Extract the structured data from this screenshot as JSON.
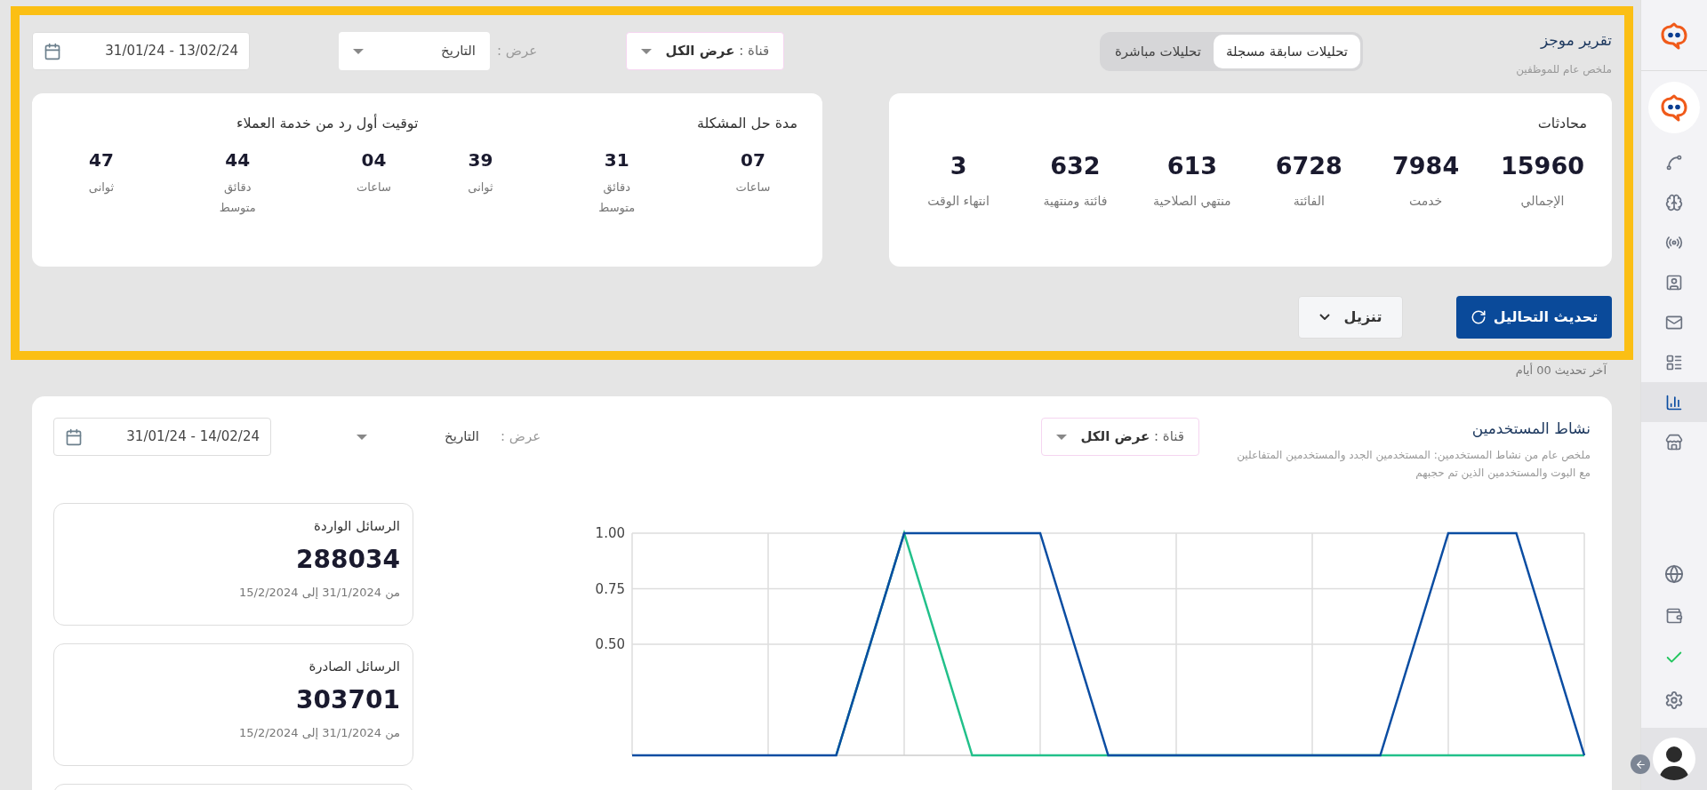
{
  "highlight_frame": true,
  "summary": {
    "title": "تقرير موجز",
    "subtitle": "ملخص عام للموظفين",
    "tabs": [
      {
        "label": "تحليلات سابقة مسجلة",
        "selected": true
      },
      {
        "label": "تحليلات مباشرة",
        "selected": false
      }
    ],
    "channel_filter": {
      "label": "قناة :",
      "value": "عرض الكل"
    },
    "view_filter": {
      "label": "عرض :",
      "value": "التاريخ"
    },
    "date_range": "31/01/24 - 13/02/24",
    "conversations": {
      "title": "محادثات",
      "stats": [
        {
          "value": "15960",
          "label": "الإجمالي"
        },
        {
          "value": "7984",
          "label": "خدمت"
        },
        {
          "value": "6728",
          "label": "الفائتة"
        },
        {
          "value": "613",
          "label": "منتهي الصلاحية"
        },
        {
          "value": "632",
          "label": "فائتة ومنتهية"
        },
        {
          "value": "3",
          "label": "انتهاء الوقت"
        }
      ]
    },
    "timing": [
      {
        "title": "مدة حل المشكلة",
        "stats": [
          {
            "value": "07",
            "label": "ساعات"
          },
          {
            "value": "31",
            "label": "دقائق",
            "note": "متوسط"
          },
          {
            "value": "39",
            "label": "ثوانى"
          }
        ]
      },
      {
        "title": "توقيت أول رد من خدمة العملاء",
        "stats": [
          {
            "value": "04",
            "label": "ساعات"
          },
          {
            "value": "44",
            "label": "دقائق",
            "note": "متوسط"
          },
          {
            "value": "47",
            "label": "ثوانى"
          }
        ]
      }
    ],
    "refresh_button": "تحديث التحاليل",
    "download_button": "تنزيل",
    "last_update": "آخر تحديث 00 أيام"
  },
  "activity": {
    "title": "نشاط المستخدمين",
    "subtitle": "ملخص عام من نشاط المستخدمين: المستخدمين الجدد والمستخدمين المتفاعلين مع البوت والمستخدمين الذين تم حجبهم",
    "channel_filter": {
      "label": "قناة :",
      "value": "عرض الكل"
    },
    "view_filter": {
      "label": "عرض :",
      "value": "التاريخ"
    },
    "date_range": "31/01/24 - 14/02/24",
    "metrics": [
      {
        "title": "الرسائل الواردة",
        "value": "288034",
        "period": "من 31/1/2024 إلى 15/2/2024"
      },
      {
        "title": "الرسائل الصادرة",
        "value": "303701",
        "period": "من 31/1/2024 إلى 15/2/2024"
      }
    ],
    "chart_data": {
      "type": "line",
      "grid": true,
      "ylim": [
        0,
        1
      ],
      "yticks": [
        {
          "value": 0.5,
          "label": "0.50"
        },
        {
          "value": 0.75,
          "label": "0.75"
        },
        {
          "value": 1,
          "label": "1.00"
        }
      ],
      "series": [
        {
          "color": "#22c08a",
          "values": [
            null,
            null,
            null,
            0,
            1,
            0,
            0,
            0,
            0,
            0,
            0,
            0,
            0,
            0,
            0
          ]
        },
        {
          "color": "#0b4da2",
          "values": [
            0,
            0,
            0,
            0,
            1,
            1,
            1,
            0,
            0,
            0,
            0,
            0,
            1,
            1,
            0
          ]
        }
      ]
    }
  },
  "sidebar": {
    "items": [
      {
        "selected": false
      },
      {
        "selected": false
      },
      {
        "selected": false
      },
      {
        "selected": false
      },
      {
        "selected": false
      },
      {
        "selected": false
      },
      {
        "selected": true
      },
      {
        "selected": false
      }
    ]
  }
}
